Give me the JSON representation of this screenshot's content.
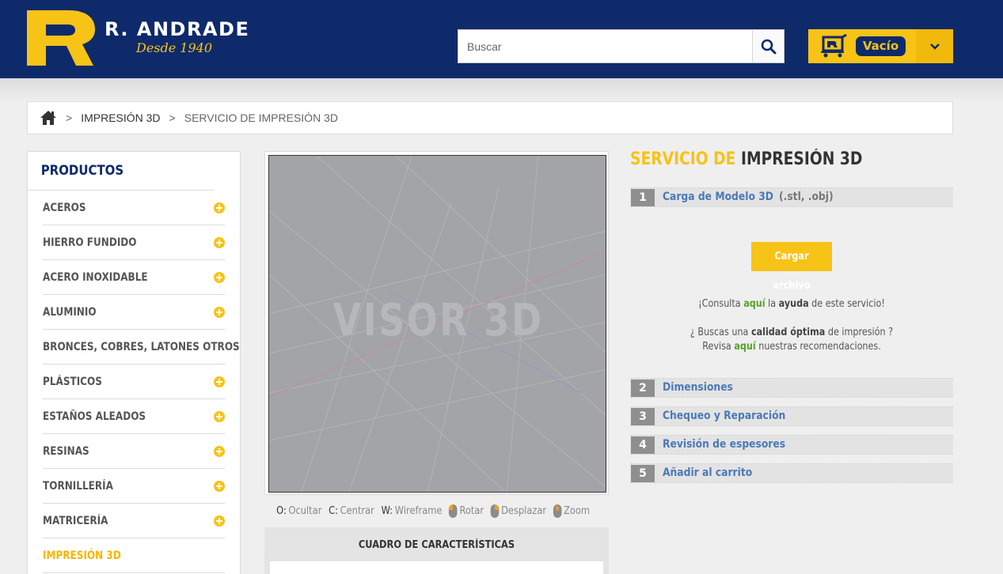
{
  "header": {
    "brand_name": "R. ANDRADE",
    "brand_tagline": "Desde 1940",
    "search_placeholder": "Buscar",
    "cart_label": "Vacío"
  },
  "breadcrumb": {
    "items": [
      "IMPRESIÓN 3D",
      "SERVICIO DE IMPRESIÓN 3D"
    ],
    "separator": ">"
  },
  "sidebar": {
    "title": "PRODUCTOS",
    "categories": [
      "ACEROS",
      "HIERRO FUNDIDO",
      "ACERO INOXIDABLE",
      "ALUMINIO",
      "BRONCES, COBRES, LATONES OTROS",
      "PLÁSTICOS",
      "ESTAÑOS ALEADOS",
      "RESINAS",
      "TORNILLERÍA",
      "MATRICERÍA",
      "IMPRESIÓN 3D"
    ],
    "active_category": "IMPRESIÓN 3D"
  },
  "viewer": {
    "watermark": "VISOR 3D",
    "controls": {
      "hide_key": "O:",
      "hide_label": "Ocultar",
      "center_key": "C:",
      "center_label": "Centrar",
      "wire_key": "W:",
      "wire_label": "Wireframe",
      "rotate_label": "Rotar",
      "pan_label": "Desplazar",
      "zoom_label": "Zoom"
    },
    "features_title": "CUADRO DE CARACTERÍSTICAS"
  },
  "service": {
    "title_part1": "SERVICIO DE",
    "title_part2": "IMPRESIÓN 3D",
    "steps": [
      {
        "num": "1",
        "label": "Carga de Modelo 3D",
        "ext": "(.stl, .obj)"
      },
      {
        "num": "2",
        "label": "Dimensiones"
      },
      {
        "num": "3",
        "label": "Chequeo y Reparación"
      },
      {
        "num": "4",
        "label": "Revisión de espesores"
      },
      {
        "num": "5",
        "label": "Añadir al carrito"
      }
    ],
    "upload_button": "Cargar archivo",
    "help_line1": {
      "pre": "¡Consulta",
      "link": "aquí",
      "mid": "la",
      "bold": "ayuda",
      "post": "de este servicio!"
    },
    "help_line2": {
      "pre": "¿ Buscas una",
      "bold": "calidad óptima",
      "post": "de impresión ?"
    },
    "help_line3": {
      "pre": "Revisa",
      "link": "aquí",
      "post": "nuestras recomendaciones."
    }
  },
  "colors": {
    "header_bg": "#0e2a6b",
    "accent_yellow": "#f7c316",
    "link_blue": "#4a7ab5",
    "link_green": "#5aa02c"
  }
}
